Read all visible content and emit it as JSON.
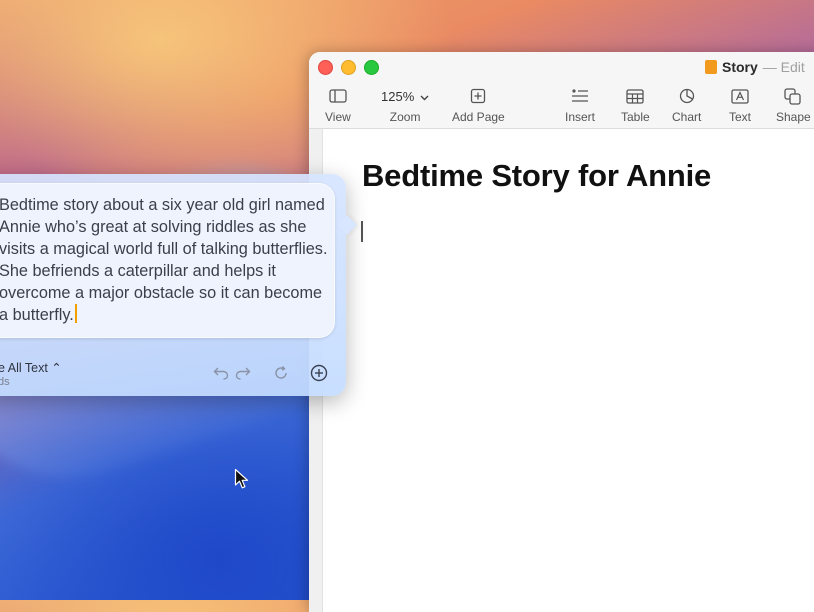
{
  "window": {
    "title": "Story",
    "title_status": "— Edit"
  },
  "toolbar": {
    "view_label": "View",
    "zoom_value": "125%",
    "zoom_label": "Zoom",
    "add_page_label": "Add Page",
    "insert_label": "Insert",
    "table_label": "Table",
    "chart_label": "Chart",
    "text_label": "Text",
    "shape_label": "Shape"
  },
  "document": {
    "heading": "Bedtime Story for Annie"
  },
  "writing_tools": {
    "prompt_text": "Bedtime story about a six year old girl named Annie who’s great at solving riddles as she visits a magical world full of talking butterflies. She befriends a caterpillar and helps it overcome a major obstacle so it can become a butterfly.",
    "footer_label": "e All Text ⌃",
    "footer_sub": "ds"
  },
  "icons": [
    "sidebar-icon",
    "chevron-down-icon",
    "add-page-icon",
    "insert-icon",
    "table-icon",
    "chart-icon",
    "text-box-icon",
    "shape-icon",
    "undo-icon",
    "redo-icon",
    "refresh-icon",
    "plus-circle-icon",
    "mouse-pointer-icon"
  ]
}
